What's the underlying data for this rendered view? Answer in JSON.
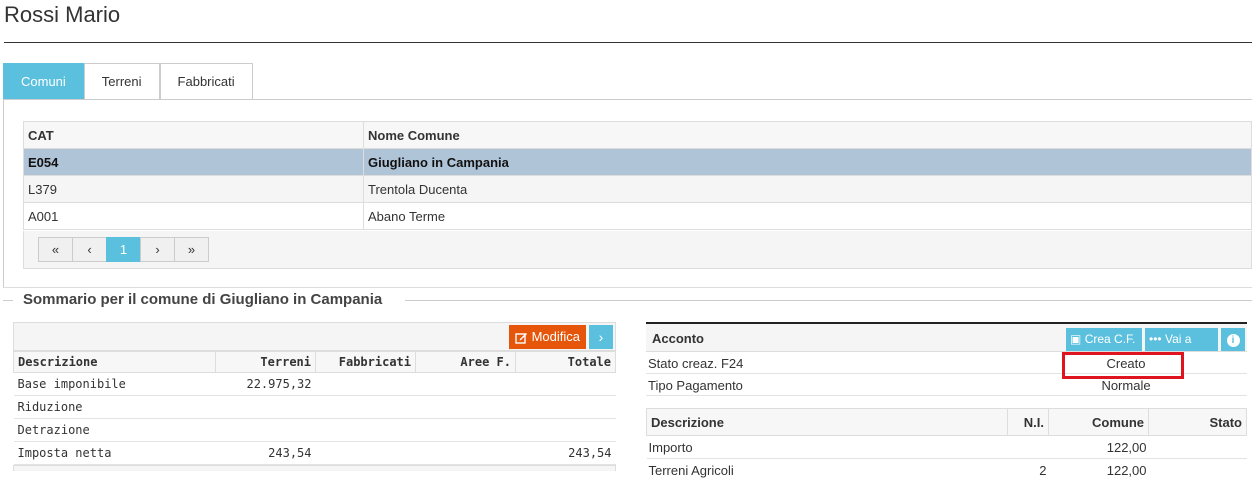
{
  "page": {
    "title": "Rossi Mario"
  },
  "tabs": [
    {
      "label": "Comuni",
      "active": true
    },
    {
      "label": "Terreni",
      "active": false
    },
    {
      "label": "Fabbricati",
      "active": false
    }
  ],
  "comuni_grid": {
    "headers": [
      "CAT",
      "Nome Comune"
    ],
    "rows": [
      {
        "cat": "E054",
        "nome": "Giugliano in Campania",
        "selected": true
      },
      {
        "cat": "L379",
        "nome": "Trentola Ducenta",
        "selected": false
      },
      {
        "cat": "A001",
        "nome": "Abano Terme",
        "selected": false
      }
    ],
    "pager": {
      "first": "«",
      "prev": "‹",
      "current": "1",
      "next": "›",
      "last": "»"
    }
  },
  "summary": {
    "legend": "Sommario per il comune di Giugliano in Campania",
    "modifica_label": "Modifica",
    "headers": [
      "Descrizione",
      "Terreni",
      "Fabbricati",
      "Aree F.",
      "Totale"
    ],
    "rows": [
      [
        "Base imponibile",
        "22.975,32",
        "",
        "",
        ""
      ],
      [
        "Riduzione",
        "",
        "",
        "",
        ""
      ],
      [
        "Detrazione",
        "",
        "",
        "",
        ""
      ],
      [
        "Imposta netta",
        "243,54",
        "",
        "",
        "243,54"
      ]
    ]
  },
  "acconto": {
    "title": "Acconto",
    "crea_cf_label": "Crea C.F.",
    "vai_cf_label": "Vai a C.F.",
    "stato_label": "Stato creaz. F24",
    "stato_value": "Creato",
    "tipo_label": "Tipo Pagamento",
    "tipo_value": "Normale",
    "table_headers": [
      "Descrizione",
      "N.I.",
      "Comune",
      "Stato"
    ],
    "table_rows": [
      [
        "Importo",
        "",
        "122,00",
        ""
      ],
      [
        "Terreni Agricoli",
        "2",
        "122,00",
        ""
      ]
    ]
  },
  "colors": {
    "accent": "#5bc0de",
    "modifica": "#e5560b",
    "highlight": "#e0141e",
    "selected_row": "#b0c4d8"
  }
}
